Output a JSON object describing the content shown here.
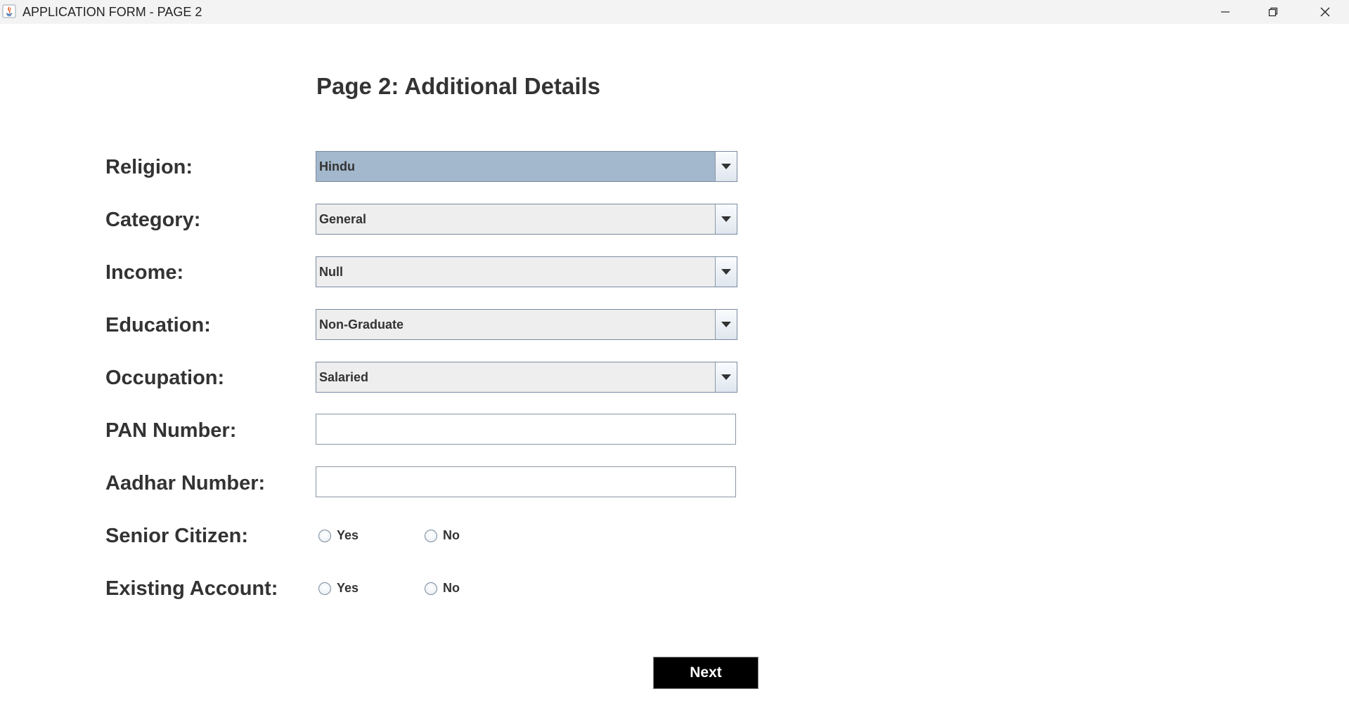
{
  "window": {
    "title": "APPLICATION FORM - PAGE 2",
    "icon": "java-icon",
    "controls": [
      "minimize-icon",
      "restore-icon",
      "close-icon"
    ]
  },
  "form": {
    "heading": "Page 2: Additional Details",
    "fields": {
      "religion": {
        "label": "Religion:",
        "value": "Hindu",
        "focused": true
      },
      "category": {
        "label": "Category:",
        "value": "General"
      },
      "income": {
        "label": "Income:",
        "value": "Null"
      },
      "education": {
        "label": "Education:",
        "value": "Non-Graduate"
      },
      "occupation": {
        "label": "Occupation:",
        "value": "Salaried"
      },
      "pan": {
        "label": "PAN Number:",
        "value": ""
      },
      "aadhar": {
        "label": "Aadhar Number:",
        "value": ""
      },
      "senior_citizen": {
        "label": "Senior Citizen:",
        "options": [
          "Yes",
          "No"
        ],
        "selected": null
      },
      "existing_account": {
        "label": "Existing Account:",
        "options": [
          "Yes",
          "No"
        ],
        "selected": null
      }
    },
    "next_button": "Next"
  },
  "colors": {
    "titlebar": "#f3f3f3",
    "combo_selected": "#a3b8cc",
    "combo_bg": "#eeeeee",
    "button_bg": "#000000",
    "text": "#333333"
  }
}
